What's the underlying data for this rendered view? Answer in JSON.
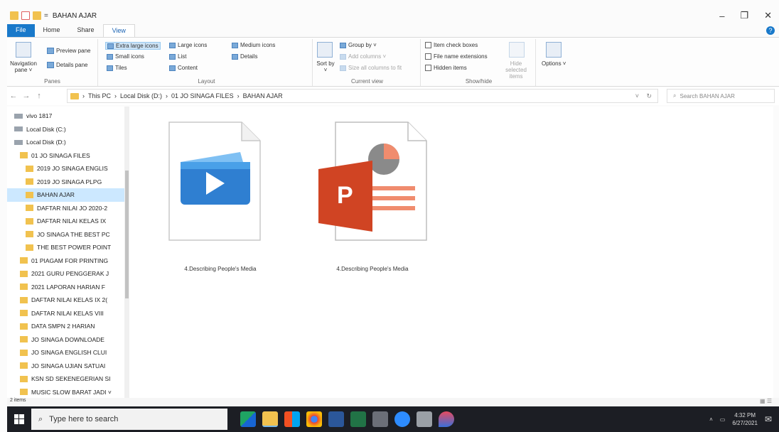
{
  "window": {
    "title": "BAHAN AJAR",
    "qa_sep": "=",
    "minimize": "–",
    "maximize": "❐",
    "close": "✕"
  },
  "ribbon_tabs": [
    "File",
    "Home",
    "Share",
    "View"
  ],
  "ribbon": {
    "panes": {
      "nav_pane": "Navigation pane ˅",
      "preview_pane": "Preview pane",
      "details_pane": "Details pane",
      "label": "Panes"
    },
    "layout": {
      "items": [
        "Extra large icons",
        "Large icons",
        "Medium icons",
        "Small icons",
        "List",
        "Details",
        "Tiles",
        "Content"
      ],
      "label": "Layout"
    },
    "current_view": {
      "sort_by": "Sort by ˅",
      "group_by": "Group by ˅",
      "add_columns": "Add columns ˅",
      "size_all": "Size all columns to fit",
      "label": "Current view"
    },
    "show_hide": {
      "item_check_boxes": "Item check boxes",
      "file_name_extensions": "File name extensions",
      "hidden_items": "Hidden items",
      "hide_selected": "Hide selected items",
      "label": "Show/hide"
    },
    "options": "Options ˅"
  },
  "address": {
    "back": "←",
    "forward": "→",
    "up": "↑",
    "path": [
      "This PC",
      "Local Disk (D:)",
      "01 JO SINAGA FILES",
      "BAHAN AJAR"
    ],
    "dropdown": "˅",
    "refresh": "↻",
    "search_placeholder": "Search BAHAN AJAR"
  },
  "nav_tree": [
    {
      "label": "vivo 1817",
      "type": "device",
      "indent": 0
    },
    {
      "label": "Local Disk (C:)",
      "type": "drive",
      "indent": 0
    },
    {
      "label": "Local Disk (D:)",
      "type": "drive",
      "indent": 0
    },
    {
      "label": "01 JO SINAGA FILES",
      "type": "folder",
      "indent": 1
    },
    {
      "label": "2019 JO SINAGA ENGLIS",
      "type": "folder",
      "indent": 2
    },
    {
      "label": "2019 JO SINAGA PLPG",
      "type": "folder",
      "indent": 2
    },
    {
      "label": "BAHAN AJAR",
      "type": "folder",
      "indent": 2,
      "selected": true
    },
    {
      "label": "DAFTAR NILAI JO 2020-2",
      "type": "folder",
      "indent": 2
    },
    {
      "label": "DAFTAR NILAI KELAS IX",
      "type": "folder",
      "indent": 2
    },
    {
      "label": "JO SINAGA THE BEST PC",
      "type": "folder",
      "indent": 2
    },
    {
      "label": "THE BEST POWER POINT",
      "type": "folder",
      "indent": 2
    },
    {
      "label": "01 PIAGAM FOR PRINTING",
      "type": "folder",
      "indent": 1
    },
    {
      "label": "2021 GURU PENGGERAK J",
      "type": "folder",
      "indent": 1
    },
    {
      "label": "2021 LAPORAN HARIAN F",
      "type": "folder",
      "indent": 1
    },
    {
      "label": "DAFTAR NILAI KELAS IX 2(",
      "type": "folder",
      "indent": 1
    },
    {
      "label": "DAFTAR NILAI KELAS VIII",
      "type": "folder",
      "indent": 1
    },
    {
      "label": "DATA SMPN 2 HARIAN",
      "type": "folder",
      "indent": 1
    },
    {
      "label": "JO SINAGA DOWNLOADE",
      "type": "folder",
      "indent": 1
    },
    {
      "label": "JO SINAGA ENGLISH CLUI",
      "type": "folder",
      "indent": 1
    },
    {
      "label": "JO SINAGA UJIAN SATUAI",
      "type": "folder",
      "indent": 1
    },
    {
      "label": "KSN SD SEKENEGERIAN SI",
      "type": "folder",
      "indent": 1
    },
    {
      "label": "MUSIC SLOW BARAT JADI ˅",
      "type": "folder",
      "indent": 1
    }
  ],
  "files": [
    {
      "name": "4.Describing People's Media",
      "kind": "video"
    },
    {
      "name": "4.Describing People's Media",
      "kind": "powerpoint"
    }
  ],
  "status": {
    "count": "2 items"
  },
  "taskbar": {
    "search_placeholder": "Type here to search",
    "time": "4:32 PM",
    "date": "6/27/2021",
    "tray_chevron": "˄"
  },
  "colors": {
    "accent": "#1979ca",
    "folder": "#f1c24f",
    "selection": "#cce8ff",
    "ppt_red": "#d04423",
    "video_blue": "#2f7fd1",
    "taskbar": "#1c1e24"
  }
}
